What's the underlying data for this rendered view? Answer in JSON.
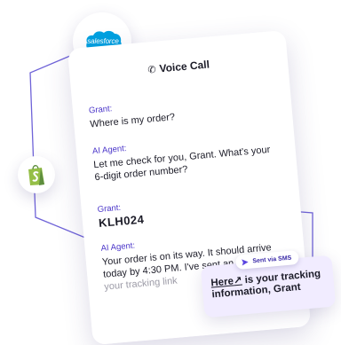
{
  "badges": {
    "salesforce": {
      "label": "salesforce",
      "color": "#00a1e0"
    },
    "shopify": {
      "color": "#95bf47"
    }
  },
  "call": {
    "title": "Voice Call",
    "messages": [
      {
        "speaker": "Grant:",
        "text": "Where is my order?"
      },
      {
        "speaker": "AI Agent:",
        "text": "Let me check for you, Grant. What's your 6-digit order number?"
      },
      {
        "speaker": "Grant:",
        "text": "KLH024"
      },
      {
        "speaker": "AI Agent:",
        "text_main": "Your order is on its way. It should arrive today by 4:30 PM. I've sent an SMS ",
        "text_faded": "with your tracking link"
      }
    ]
  },
  "sms": {
    "pill_label": "Sent via SMS",
    "link_text": "Here",
    "link_arrow": "↗",
    "body_text": " is your tracking information, Grant"
  },
  "colors": {
    "accent": "#4a35c9",
    "line": "#6f63d8",
    "sms_bg": "#f1ecff"
  }
}
